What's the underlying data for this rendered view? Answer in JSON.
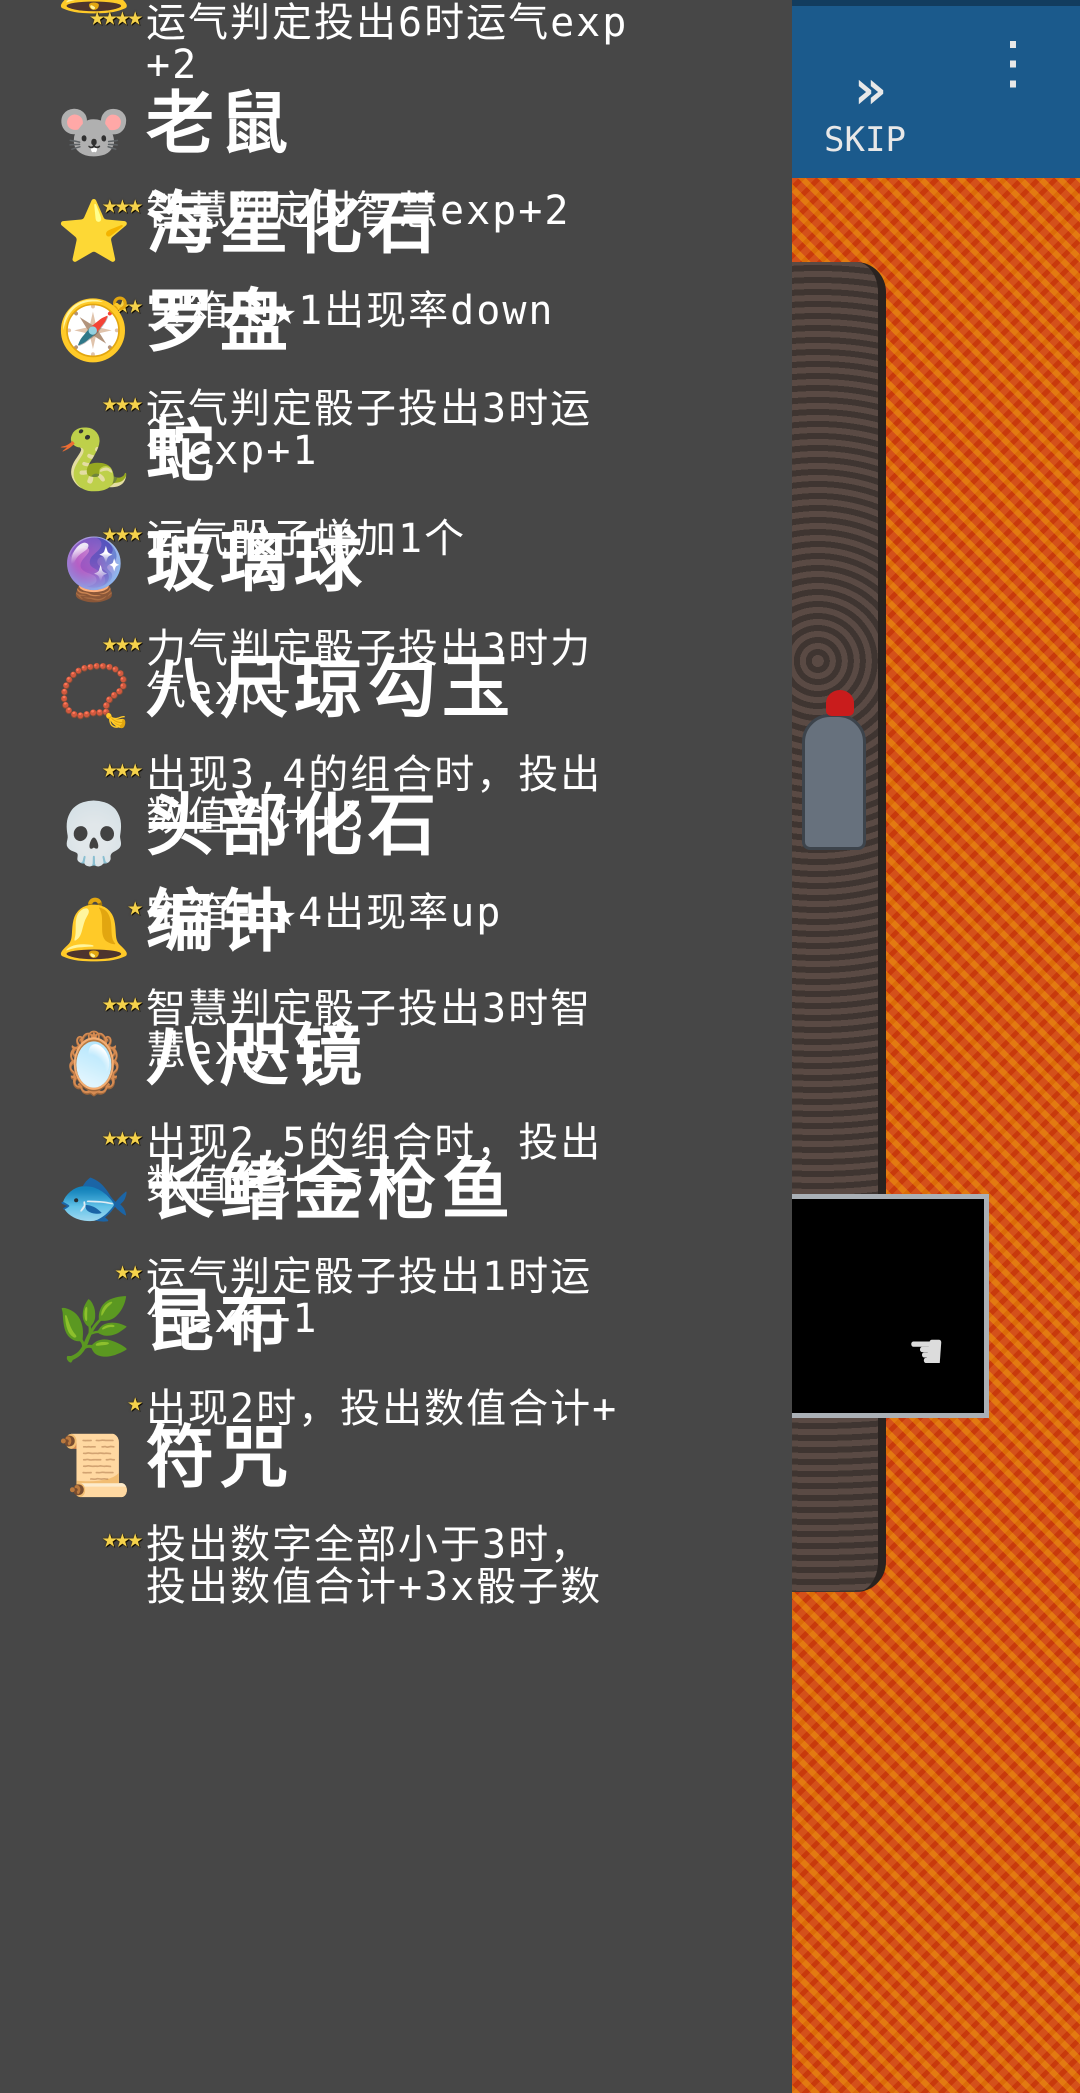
{
  "items": [
    {
      "icon": "bell-charm-icon",
      "glyph": "🔔",
      "stars": "★★★★",
      "name": "",
      "desc": "运气判定投出6时运气exp\n+2"
    },
    {
      "icon": "mouse-icon",
      "glyph": "🐭",
      "stars": "★★★",
      "name": "老鼠",
      "desc": "智慧判定时智慧exp+2"
    },
    {
      "icon": "starfish-fossil-icon",
      "glyph": "⭐",
      "stars": "★★",
      "name": "海星化石",
      "desc": "宝箱中★1出现率down"
    },
    {
      "icon": "compass-icon",
      "glyph": "🧭",
      "stars": "★★★",
      "name": "罗盘",
      "desc": "运气判定骰子投出3时运\n气exp+1"
    },
    {
      "icon": "snake-icon",
      "glyph": "🐍",
      "stars": "★★★",
      "name": "蛇",
      "desc": "运气骰子增加1个"
    },
    {
      "icon": "glass-ball-icon",
      "glyph": "🔮",
      "stars": "★★★",
      "name": "玻璃球",
      "desc": "力气判定骰子投出3时力\n气exp+1"
    },
    {
      "icon": "magatama-icon",
      "glyph": "📿",
      "stars": "★★★",
      "name": "八尺琼勾玉",
      "desc": "出现3,4的组合时，投出\n数值合计+5"
    },
    {
      "icon": "skull-fossil-icon",
      "glyph": "💀",
      "stars": "★",
      "name": "头部化石",
      "desc": "宝箱中★4出现率up"
    },
    {
      "icon": "bell-icon",
      "glyph": "🔔",
      "stars": "★★★",
      "name": "编钟",
      "desc": "智慧判定骰子投出3时智\n慧exp+1"
    },
    {
      "icon": "mirror-icon",
      "glyph": "🪞",
      "stars": "★★★",
      "name": "八咫镜",
      "desc": "出现2,5的组合时，投出\n数值合计+5"
    },
    {
      "icon": "tuna-icon",
      "glyph": "🐟",
      "stars": "★★",
      "name": "长鳍金枪鱼",
      "desc": "运气判定骰子投出1时运\n气exp+1"
    },
    {
      "icon": "kelp-icon",
      "glyph": "🌿",
      "stars": "★",
      "name": "昆布",
      "desc": "出现2时，投出数值合计+\n1"
    },
    {
      "icon": "talisman-icon",
      "glyph": "📜",
      "stars": "★★★",
      "name": "符咒",
      "desc": "投出数字全部小于3时，\n投出数值合计+3x骰子数"
    }
  ],
  "topbar": {
    "skip_icon": "»",
    "skip_label": "SKIP",
    "menu_icon": "⋮"
  },
  "colors": {
    "panel_bg": "#474747",
    "topbar_bg": "#1b5a8c",
    "star": "#f5d24b",
    "lava": "#d4501a"
  }
}
